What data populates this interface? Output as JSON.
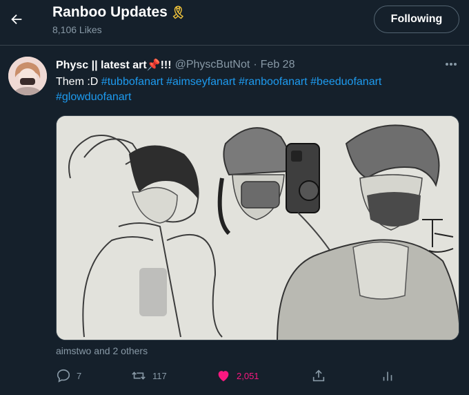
{
  "header": {
    "title": "Ranboo Updates",
    "title_emoji": "🎗",
    "subtitle": "8,106 Likes",
    "follow_label": "Following"
  },
  "tweet": {
    "display_name": "Physc || latest art📌!!!",
    "handle": "@PhyscButNot",
    "separator": "·",
    "date": "Feb 28",
    "text_prefix": "Them :D ",
    "hashtags": [
      "#tubbofanart",
      "#aimseyfanart",
      "#ranboofanart",
      "#beeduofanart",
      "#glowduofanart"
    ],
    "artist_signature": "TPhy",
    "liked_by": "aimstwo and 2 others",
    "counts": {
      "replies": "7",
      "retweets": "117",
      "likes": "2,051"
    }
  },
  "colors": {
    "background": "#15202b",
    "secondary_text": "#8899a6",
    "link": "#1d9bf0",
    "like": "#f91880",
    "border": "#38444d"
  },
  "icons": {
    "back": "arrow-left-icon",
    "more": "more-horizontal-icon",
    "reply": "reply-icon",
    "retweet": "retweet-icon",
    "like": "heart-filled-icon",
    "share": "share-icon",
    "analytics": "analytics-icon"
  }
}
